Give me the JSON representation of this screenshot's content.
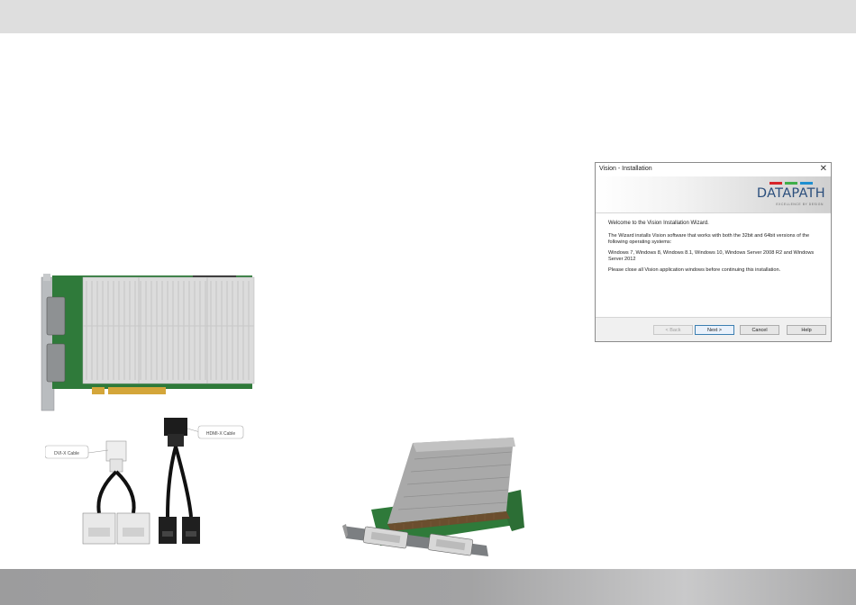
{
  "colors": {
    "top_bar": "#dedede",
    "bottom_bar": "#a0a0a1",
    "brand_blue": "#2a4e7c",
    "brand_red": "#d6242a",
    "brand_green": "#3fae49",
    "brand_cyan": "#1e8fd0"
  },
  "cables": {
    "dvi_label": "DVI-X Cable",
    "hdmi_label": "HDMI-X Cable"
  },
  "dialog": {
    "title": "Vision - Installation",
    "close_icon": "close-icon",
    "logo_text": "DATAPATH",
    "logo_tagline": "EXCELLENCE BY DESIGN",
    "welcome": "Welcome to the Vision Installation Wizard.",
    "para1": "The Wizard installs Vision software that works with both the 32bit and 64bit versions of the following operating systems:",
    "para2": "Windows 7, Windows 8, Windows 8.1, Windows 10, Windows Server 2008 R2 and Windows Server 2012",
    "para3": "Please close all Vision application windows before continuing this installation.",
    "buttons": {
      "back": "< Back",
      "next": "Next >",
      "cancel": "Cancel",
      "help": "Help"
    }
  }
}
